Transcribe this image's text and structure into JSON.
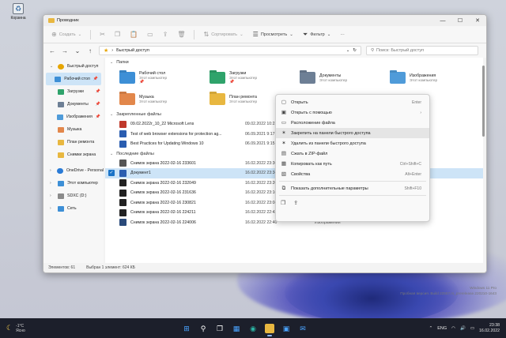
{
  "desktop": {
    "recycle_bin_label": "Корзина"
  },
  "window": {
    "title": "Проводник",
    "controls": {
      "minimize": "—",
      "maximize": "☐",
      "close": "✕"
    }
  },
  "ribbon": {
    "create": "Создать",
    "sort": "Сортировать",
    "view": "Просмотреть",
    "filter": "Фильтр",
    "more": "···"
  },
  "address": {
    "path": "Быстрый доступ",
    "search_placeholder": "Поиск: Быстрый доступ"
  },
  "sidebar": {
    "items": [
      {
        "label": "Быстрый доступ",
        "pin": "",
        "icon_color": "#e6a500"
      },
      {
        "label": "Рабочий стол",
        "pin": "📌",
        "icon_color": "#3d8fd6"
      },
      {
        "label": "Загрузки",
        "pin": "📌",
        "icon_color": "#2fa36b"
      },
      {
        "label": "Документы",
        "pin": "📌",
        "icon_color": "#6d7f95"
      },
      {
        "label": "Изображения",
        "pin": "📌",
        "icon_color": "#4f9bd9"
      },
      {
        "label": "Музыка",
        "pin": "",
        "icon_color": "#e2874b"
      },
      {
        "label": "План ремонта",
        "pin": "",
        "icon_color": "#e8b740"
      },
      {
        "label": "Снимки экрана",
        "pin": "",
        "icon_color": "#e8b740"
      },
      {
        "label": "OneDrive - Personal",
        "pin": "",
        "icon_color": "#2a7bd6"
      },
      {
        "label": "Этот компьютер",
        "pin": "",
        "icon_color": "#3d8fd6"
      },
      {
        "label": "SDXC (D:)",
        "pin": "",
        "icon_color": "#8a8a8a"
      },
      {
        "label": "Сеть",
        "pin": "",
        "icon_color": "#3d8fd6"
      }
    ]
  },
  "main": {
    "folders_header": "Папки",
    "folders": [
      {
        "name": "Рабочий стол",
        "sub": "Этот компьютер",
        "pin": "📌",
        "color": "#3d8fd6"
      },
      {
        "name": "Загрузки",
        "sub": "Этот компьютер",
        "pin": "📌",
        "color": "#2fa36b"
      },
      {
        "name": "Документы",
        "sub": "Этот компьютер",
        "pin": "",
        "color": "#6d7f95"
      },
      {
        "name": "Изображения",
        "sub": "Этот компьютер",
        "pin": "",
        "color": "#4f9bd9"
      },
      {
        "name": "Музыка",
        "sub": "Этот компьютер",
        "pin": "",
        "color": "#e2874b"
      },
      {
        "name": "План ремонта",
        "sub": "Этот компьютер",
        "pin": "",
        "color": "#e8b740"
      }
    ],
    "pinned_header": "Закрепленные файлы",
    "pinned_files": [
      {
        "name": "09.02.2022г_10_22 Microsoft Lens",
        "date": "09.02.2022 10:23",
        "icon_color": "#c0392b"
      },
      {
        "name": "Test of web browser extensions for protection ag...",
        "date": "06.09.2021 9:17",
        "icon_color": "#2a5db0"
      },
      {
        "name": "Best Practices for Updating Windows 10",
        "date": "06.09.2021 9:15",
        "icon_color": "#2a5db0"
      }
    ],
    "recent_header": "Последние файлы",
    "recent_files": [
      {
        "name": "Снимок экрана 2022-02-16 233601",
        "date": "16.02.2022 23:36",
        "type": "",
        "icon_color": "#555",
        "selected": false
      },
      {
        "name": "Документ1",
        "date": "16.02.2022 23:34",
        "type": "",
        "icon_color": "#2a5db0",
        "selected": true
      },
      {
        "name": "Снимок экрана 2022-02-16 232049",
        "date": "16.02.2022 23:20",
        "type": "",
        "icon_color": "#222",
        "selected": false
      },
      {
        "name": "Снимок экрана 2022-02-16 231636",
        "date": "16.02.2022 23:16",
        "type": "",
        "icon_color": "#222",
        "selected": false
      },
      {
        "name": "Снимок экрана 2022-02-16 230821",
        "date": "16.02.2022 23:08",
        "type": "Изображения",
        "icon_color": "#222",
        "selected": false
      },
      {
        "name": "Снимок экрана 2022-02-16 224211",
        "date": "16.02.2022 22:42",
        "type": "Изображения",
        "icon_color": "#222",
        "selected": false
      },
      {
        "name": "Снимок экрана 2022-02-16 224006",
        "date": "16.02.2022 22:40",
        "type": "Изображения",
        "icon_color": "#222",
        "selected": false
      }
    ]
  },
  "status": {
    "count": "Элементов: 61",
    "selection": "Выбран 1 элемент: 624 КБ"
  },
  "context_menu": {
    "items": [
      {
        "label": "Открыть",
        "shortcut": "Enter",
        "icon": "▢",
        "highlight": false
      },
      {
        "label": "Открыть с помощью",
        "shortcut": "›",
        "icon": "▣",
        "highlight": false
      },
      {
        "label": "Расположение файла",
        "shortcut": "",
        "icon": "▭",
        "highlight": false
      },
      {
        "label": "Закрепить на панели быстрого доступа",
        "shortcut": "",
        "icon": "✶",
        "highlight": true
      },
      {
        "label": "Удалить из панели быстрого доступа",
        "shortcut": "",
        "icon": "✶",
        "highlight": false
      },
      {
        "label": "Сжать в ZIP-файл",
        "shortcut": "",
        "icon": "▤",
        "highlight": false
      },
      {
        "label": "Копировать как путь",
        "shortcut": "Ctrl+Shift+C",
        "icon": "▦",
        "highlight": false
      },
      {
        "label": "Свойства",
        "shortcut": "Alt+Enter",
        "icon": "▧",
        "highlight": false
      }
    ],
    "more_options": {
      "label": "Показать дополнительные параметры",
      "shortcut": "Shift+F10"
    },
    "bottom_icons": [
      "copy-icon",
      "share-icon"
    ]
  },
  "watermark": {
    "line1": "Windows 11 Pro",
    "line2": "Пробная версия. Build 22557.rs_prerelease.220210-1643"
  },
  "taskbar": {
    "weather_temp": "-1°C",
    "weather_desc": "Ясно",
    "language": "ENG",
    "time": "23:38",
    "date": "16.02.2022"
  }
}
